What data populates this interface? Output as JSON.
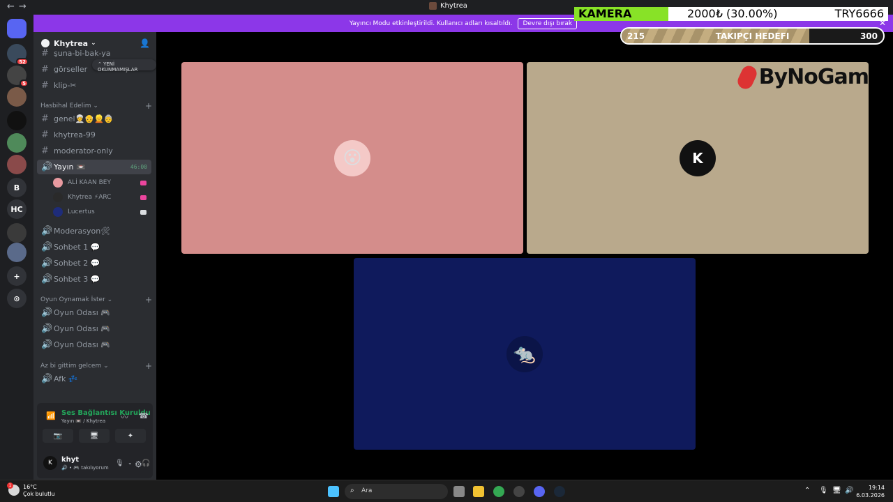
{
  "window": {
    "title": "Khytrea",
    "nav_back": "←",
    "nav_forward": "→"
  },
  "banner": {
    "message": "Yayıncı Modu etkinleştirildi. Kullanıcı adları kısaltıldı.",
    "button_label": "Devre dışı bırak",
    "close_glyph": "✕"
  },
  "rail": {
    "items": [
      {
        "label": "",
        "badge": "",
        "color": "#5865f2"
      },
      {
        "label": "",
        "badge": "52",
        "color": "#3a4a5c"
      },
      {
        "label": "",
        "badge": "5",
        "color": "#444"
      },
      {
        "label": "",
        "badge": "",
        "color": "#7a5a48"
      },
      {
        "label": "",
        "badge": "",
        "color": "#111"
      },
      {
        "label": "",
        "badge": "",
        "color": "#4f8a5a"
      },
      {
        "label": "",
        "badge": "",
        "color": "#8a4a4a"
      },
      {
        "label": "B",
        "badge": "",
        "color": "#313338"
      },
      {
        "label": "HC",
        "badge": "",
        "color": "#313338"
      },
      {
        "label": "",
        "badge": "",
        "color": "#3a3a3a"
      },
      {
        "label": "",
        "badge": "",
        "color": "#5a6a8a"
      },
      {
        "label": "+",
        "badge": "",
        "color": "#313338"
      },
      {
        "label": "⊙",
        "badge": "",
        "color": "#313338"
      }
    ]
  },
  "server": {
    "name": "Khytrea",
    "unread_pill": "YENİ OKUNMAMIŞLAR",
    "channels_top": [
      {
        "name": "şuna-bi-bak-ya",
        "sym": "#"
      },
      {
        "name": "görseller",
        "sym": "#"
      },
      {
        "name": "klip-✂",
        "sym": "#"
      }
    ],
    "categories": [
      {
        "name": "Hasbihal Edelim"
      },
      {
        "name": "Oyun Oynamak İster"
      },
      {
        "name": "Az bi gittim gelcem"
      }
    ],
    "text_channels": [
      {
        "name": "genel👳👴👱👵",
        "sym": "#"
      },
      {
        "name": "khytrea-99",
        "sym": "#"
      },
      {
        "name": "moderator-only",
        "sym": "#"
      }
    ],
    "active_voice": {
      "name": "Yayın 📼",
      "time": "46:00",
      "sym": "🔊"
    },
    "members": [
      {
        "name": "ALİ KAAN BEY",
        "color": "#e89aa0",
        "live": "#eb459e"
      },
      {
        "name": "Khytrea ⚡ARC",
        "color": "#2a2a2a",
        "live": "#eb459e"
      },
      {
        "name": "Lucertus",
        "color": "#1e2c7a",
        "live": "#dbdee1"
      }
    ],
    "voice_channels": [
      {
        "name": "Moderasyon🛠",
        "sym": "🔊"
      },
      {
        "name": "Sohbet 1 💬",
        "sym": "🔊"
      },
      {
        "name": "Sohbet 2 💬",
        "sym": "🔊"
      },
      {
        "name": "Sohbet 3 💬",
        "sym": "🔊"
      }
    ],
    "game_channels": [
      {
        "name": "Oyun Odası 🎮",
        "sym": "🔊"
      },
      {
        "name": "Oyun Odası 🎮",
        "sym": "🔊"
      },
      {
        "name": "Oyun Odası 🎮",
        "sym": "🔊"
      }
    ],
    "afk_channels": [
      {
        "name": "Afk 💤",
        "sym": "🔊"
      }
    ]
  },
  "voice_panel": {
    "status": "Ses Bağlantısı Kuruldu",
    "subtitle": "Yayın 📼 / Khytrea",
    "buttons": [
      "📷",
      "🖥",
      "✦",
      "🎉"
    ]
  },
  "user": {
    "name": "khyt",
    "status": "🔊 • 🎮 takılıyorum"
  },
  "overlay": {
    "camera_label": "KAMERA",
    "camera_value": "2000₺ (30.00%)",
    "camera_progress": 0.3,
    "camera_target": "TRY6666",
    "goal_current": "215",
    "goal_label": "TAKIPÇI HEDEFI",
    "goal_target": "300",
    "goal_progress": 0.717,
    "watermark": "ByNoGam"
  },
  "tiles": [
    {
      "name": "ALİ KAAN BEY",
      "bg": "#d48d8b"
    },
    {
      "name": "Khytrea",
      "bg": "#b9a98c",
      "avatar_text": "K"
    },
    {
      "name": "Lucertus",
      "bg": "#0f1a5c"
    }
  ],
  "taskbar": {
    "temperature": "16°C",
    "weather": "Çok bulutlu",
    "weather_badge": "1",
    "search_placeholder": "Ara",
    "time": "19:14",
    "date": "6.03.2026"
  }
}
